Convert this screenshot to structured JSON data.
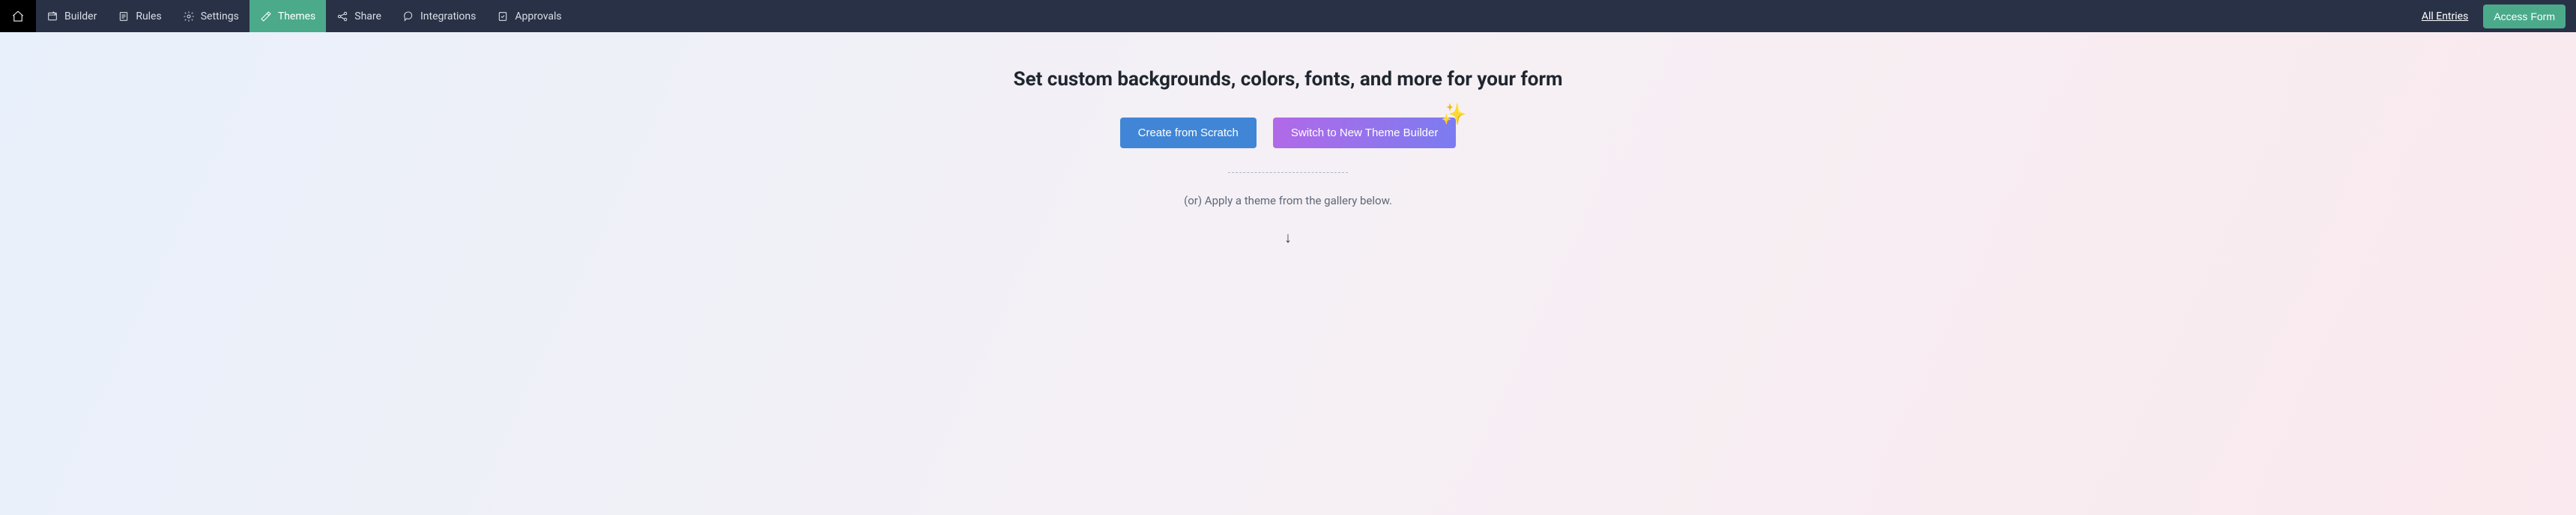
{
  "nav": {
    "items": [
      {
        "label": "Builder"
      },
      {
        "label": "Rules"
      },
      {
        "label": "Settings"
      },
      {
        "label": "Themes"
      },
      {
        "label": "Share"
      },
      {
        "label": "Integrations"
      },
      {
        "label": "Approvals"
      }
    ],
    "all_entries": "All Entries",
    "access_form": "Access Form"
  },
  "main": {
    "headline": "Set custom backgrounds, colors, fonts, and more for your form",
    "create_scratch": "Create from Scratch",
    "switch_builder": "Switch to New Theme Builder",
    "subtext": "(or) Apply a theme from the gallery below.",
    "arrow": "↓"
  }
}
